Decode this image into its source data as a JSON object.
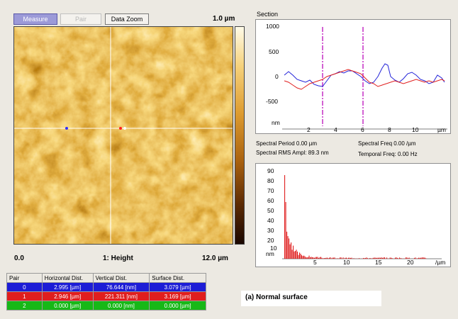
{
  "toolbar": {
    "measure_label": "Measure",
    "pair_label": "Pair",
    "data_zoom_label": "Data Zoom"
  },
  "image": {
    "scale_top": "1.0 µm",
    "x_start": "0.0",
    "channel_label": "1: Height",
    "x_end": "12.0 µm"
  },
  "section": {
    "title": "Section",
    "y_ticks": [
      "1000",
      "500",
      "0",
      "-500",
      "nm"
    ],
    "x_ticks": [
      "2",
      "4",
      "6",
      "8",
      "10",
      "µm"
    ],
    "cursor_x_um": [
      3.0,
      6.0
    ],
    "series_colors": {
      "blue": "#2323d8",
      "red": "#e02020",
      "cursor": "#c020c0"
    }
  },
  "stats": {
    "spectral_period": "Spectral Period 0.00 µm",
    "spectral_freq": "Spectral Freq 0.00 /µm",
    "spectral_rms": "Spectral RMS Ampl: 89.3 nm",
    "temporal_freq": "Temporal Freq: 0.00 Hz"
  },
  "spectrum": {
    "y_ticks": [
      "90",
      "80",
      "70",
      "60",
      "50",
      "40",
      "30",
      "20",
      "10",
      "nm"
    ],
    "x_ticks": [
      "5",
      "10",
      "15",
      "20",
      "/µm"
    ],
    "bar_color": "#e02020"
  },
  "table": {
    "headers": [
      "Pair",
      "Horizontal Dist.",
      "Vertical Dist.",
      "Surface Dist."
    ],
    "rows": [
      [
        "0",
        "2.995 [µm]",
        "76.644 [nm]",
        "3.079 [µm]"
      ],
      [
        "1",
        "2.946 [µm]",
        "221.311 [nm]",
        "3.169 [µm]"
      ],
      [
        "2",
        "0.000 [µm]",
        "0.000 [nm]",
        "0.000 [µm]"
      ]
    ]
  },
  "caption": "(a) Normal surface"
}
